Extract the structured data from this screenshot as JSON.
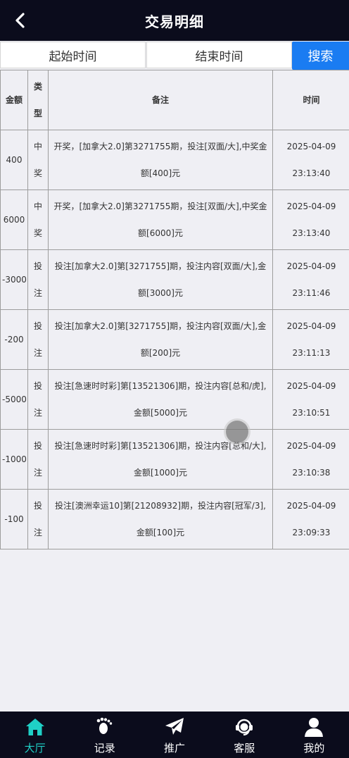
{
  "header": {
    "title": "交易明细"
  },
  "filter": {
    "start_placeholder": "起始时间",
    "end_placeholder": "结束时间",
    "search_label": "搜索"
  },
  "table": {
    "headers": {
      "amount": "金额",
      "type": "类型",
      "note": "备注",
      "time": "时间"
    },
    "rows": [
      {
        "amount": "400",
        "type": "中奖",
        "note": "开奖，[加拿大2.0]第3271755期，投注[双面/大],中奖金额[400]元",
        "date": "2025-04-09",
        "clock": "23:13:40"
      },
      {
        "amount": "6000",
        "type": "中奖",
        "note": "开奖，[加拿大2.0]第3271755期，投注[双面/大],中奖金额[6000]元",
        "date": "2025-04-09",
        "clock": "23:13:40"
      },
      {
        "amount": "-3000",
        "type": "投注",
        "note": "投注[加拿大2.0]第[3271755]期，投注内容[双面/大],金额[3000]元",
        "date": "2025-04-09",
        "clock": "23:11:46"
      },
      {
        "amount": "-200",
        "type": "投注",
        "note": "投注[加拿大2.0]第[3271755]期，投注内容[双面/大],金额[200]元",
        "date": "2025-04-09",
        "clock": "23:11:13"
      },
      {
        "amount": "-5000",
        "type": "投注",
        "note": "投注[急速时时彩]第[13521306]期，投注内容[总和/虎],金额[5000]元",
        "date": "2025-04-09",
        "clock": "23:10:51"
      },
      {
        "amount": "-1000",
        "type": "投注",
        "note": "投注[急速时时彩]第[13521306]期，投注内容[总和/大],金额[1000]元",
        "date": "2025-04-09",
        "clock": "23:10:38"
      },
      {
        "amount": "-100",
        "type": "投注",
        "note": "投注[澳洲幸运10]第[21208932]期，投注内容[冠军/3],金额[100]元",
        "date": "2025-04-09",
        "clock": "23:09:33"
      }
    ]
  },
  "tabbar": {
    "items": [
      {
        "label": "大厅",
        "icon": "home-icon",
        "active": true
      },
      {
        "label": "记录",
        "icon": "footprint-icon",
        "active": false
      },
      {
        "label": "推广",
        "icon": "paper-plane-icon",
        "active": false
      },
      {
        "label": "客服",
        "icon": "headset-icon",
        "active": false
      },
      {
        "label": "我的",
        "icon": "user-icon",
        "active": false
      }
    ]
  },
  "colors": {
    "header_bg": "#0b0c1c",
    "search_btn": "#1a7cf2",
    "active_tab": "#1fd0c6"
  }
}
